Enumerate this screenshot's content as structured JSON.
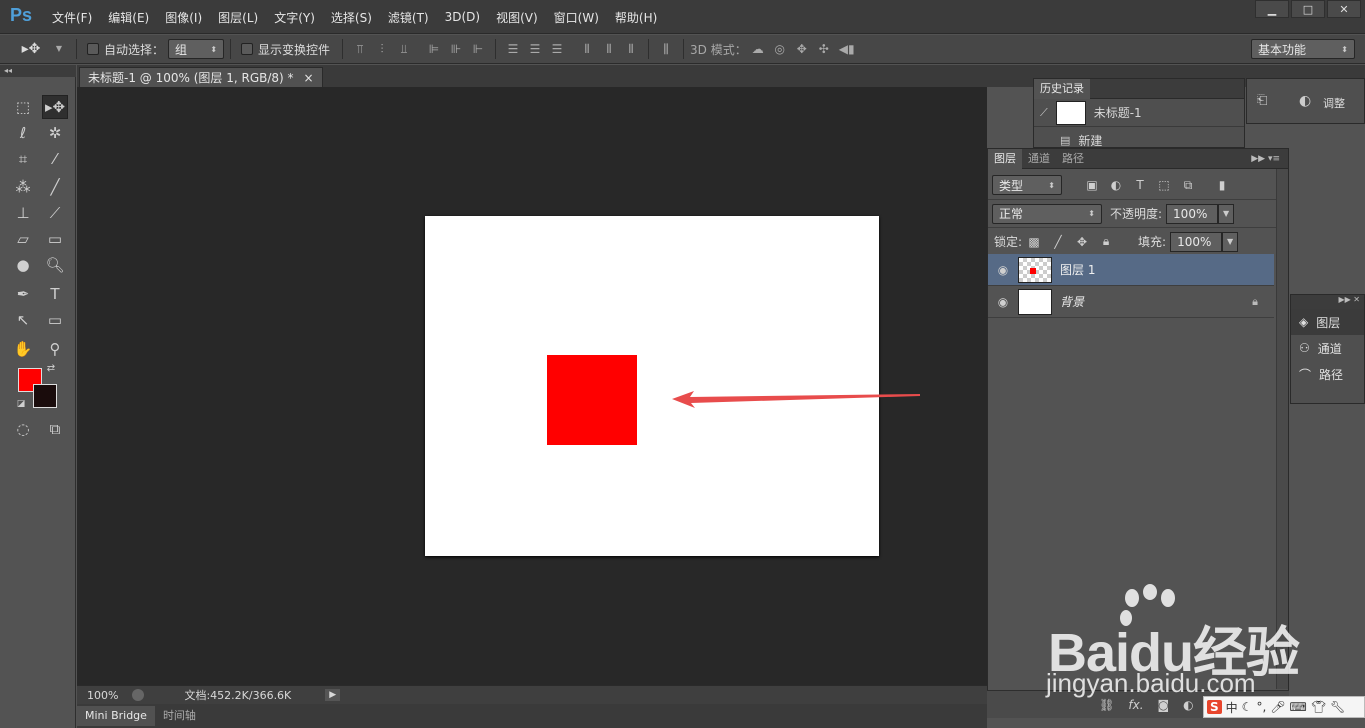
{
  "app": {
    "logo": "Ps"
  },
  "menu": [
    "文件(F)",
    "编辑(E)",
    "图像(I)",
    "图层(L)",
    "文字(Y)",
    "选择(S)",
    "滤镜(T)",
    "3D(D)",
    "视图(V)",
    "窗口(W)",
    "帮助(H)"
  ],
  "window_controls": {
    "minimize": "▁",
    "maximize": "□",
    "close": "✕"
  },
  "options": {
    "auto_select_label": "自动选择：",
    "auto_select_value": "组",
    "show_transform_label": "显示变换控件",
    "mode_3d_label": "3D 模式：",
    "workspace": "基本功能"
  },
  "document": {
    "tab_title": "未标题-1 @ 100% (图层 1, RGB/8) *",
    "tab_close": "×",
    "canvas_bg": "#ffffff",
    "shape_color": "#ff0000",
    "arrow_color": "#e84c4c"
  },
  "colors": {
    "foreground": "#ff0000",
    "background": "#1a0c0c"
  },
  "status": {
    "zoom": "100%",
    "doc_size": "文档:452.2K/366.6K"
  },
  "bottom_tabs": [
    "Mini Bridge",
    "时间轴"
  ],
  "history": {
    "tab": "历史记录",
    "items": [
      {
        "label": "未标题-1"
      },
      {
        "label": "新建"
      }
    ]
  },
  "adjust": {
    "label": "调整"
  },
  "layers": {
    "tabs": [
      "图层",
      "通道",
      "路径"
    ],
    "filter_label": "类型",
    "blend_mode": "正常",
    "opacity_label": "不透明度:",
    "opacity_value": "100%",
    "lock_label": "锁定:",
    "fill_label": "填充:",
    "fill_value": "100%",
    "items": [
      {
        "name": "图层 1",
        "selected": true,
        "locked": false
      },
      {
        "name": "背景",
        "selected": false,
        "locked": true
      }
    ],
    "footer_fx": "fx."
  },
  "mini_panel": [
    "图层",
    "通道",
    "路径"
  ],
  "watermark": {
    "main": "Baidu经验",
    "sub": "jingyan.baidu.com"
  },
  "ime": {
    "label": "中"
  }
}
